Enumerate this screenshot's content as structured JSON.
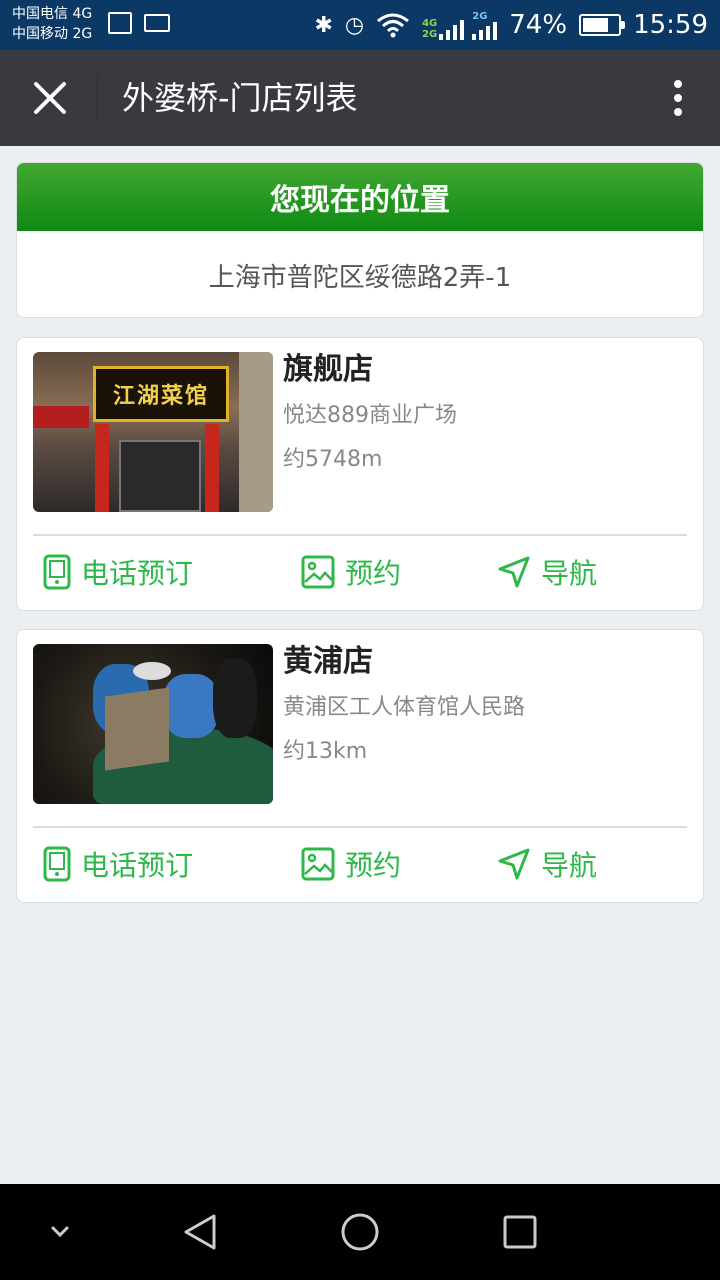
{
  "status_bar": {
    "carrier_1": "中国电信 4G",
    "carrier_2": "中国移动 2G",
    "net_a": "4G",
    "net_b": "2G",
    "net_c": "2G",
    "battery": "74%",
    "battery_level": 0.74,
    "time": "15:59",
    "icons": [
      "image-icon",
      "keyboard-icon",
      "bluetooth-icon",
      "alarm-icon",
      "wifi-icon",
      "signal-icon",
      "battery-icon"
    ]
  },
  "header": {
    "title": "外婆桥-门店列表",
    "close_icon": "close-icon",
    "more_icon": "more-vertical-icon"
  },
  "location": {
    "heading": "您现在的位置",
    "address": "上海市普陀区绥德路2弄-1"
  },
  "stores": [
    {
      "name": "旗舰店",
      "address": "悦达889商业广场",
      "distance": "约5748m",
      "image_sign_text": "江湖菜馆"
    },
    {
      "name": "黄浦店",
      "address": "黄浦区工人体育馆人民路",
      "distance": "约13km"
    }
  ],
  "actions": {
    "phone": "电话预订",
    "reserve": "预约",
    "navigate": "导航"
  },
  "colors": {
    "status_bar_bg": "#0c3866",
    "title_bar_bg": "#393a3f",
    "accent_green": "#2eb84a",
    "header_green": "#169118",
    "page_bg": "#ebeef0"
  },
  "nav_bar": {
    "icons": [
      "chevron-down-icon",
      "back-icon",
      "home-icon",
      "recents-icon"
    ]
  }
}
